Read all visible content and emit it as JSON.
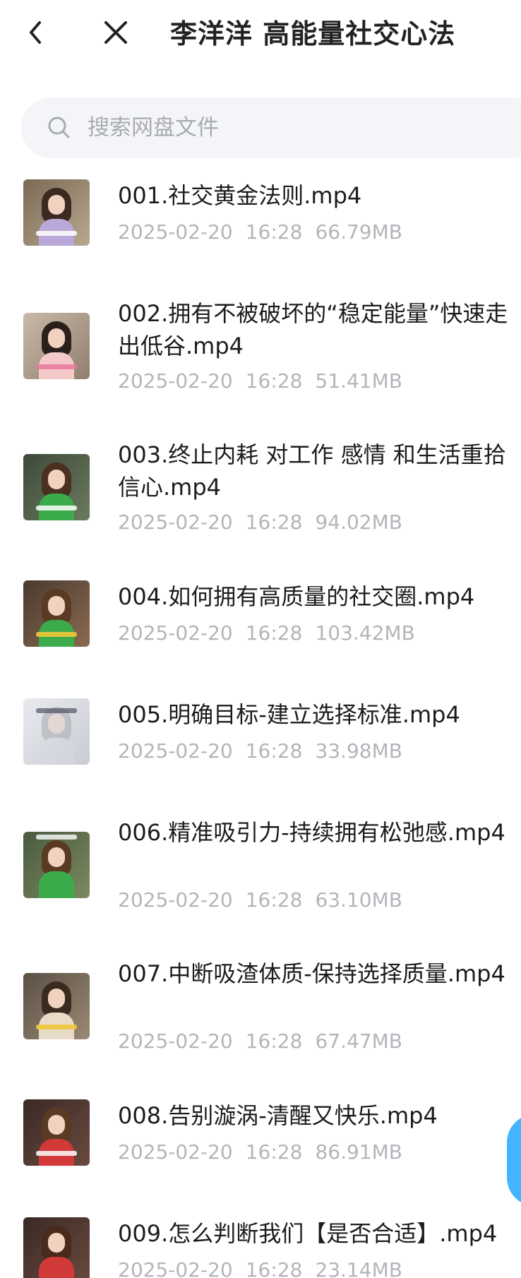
{
  "header": {
    "title": "李洋洋 高能量社交心法"
  },
  "search": {
    "placeholder": "搜索网盘文件"
  },
  "files": [
    {
      "name": "001.社交黄金法则.mp4",
      "date": "2025-02-20",
      "time": "16:28",
      "size": "66.79MB"
    },
    {
      "name": "002.拥有不被破坏的“稳定能量”快速走出低谷.mp4",
      "date": "2025-02-20",
      "time": "16:28",
      "size": "51.41MB"
    },
    {
      "name": "003.终止内耗  对工作 感情 和生活重拾信心.mp4",
      "date": "2025-02-20",
      "time": "16:28",
      "size": "94.02MB"
    },
    {
      "name": "004.如何拥有高质量的社交圈.mp4",
      "date": "2025-02-20",
      "time": "16:28",
      "size": "103.42MB"
    },
    {
      "name": "005.明确目标-建立选择标准.mp4",
      "date": "2025-02-20",
      "time": "16:28",
      "size": "33.98MB"
    },
    {
      "name": "006.精准吸引力-持续拥有松弛感.mp4",
      "date": "2025-02-20",
      "time": "16:28",
      "size": "63.10MB"
    },
    {
      "name": "007.中断吸渣体质-保持选择质量.mp4",
      "date": "2025-02-20",
      "time": "16:28",
      "size": "67.47MB"
    },
    {
      "name": "008.告别漩涡-清醒又快乐.mp4",
      "date": "2025-02-20",
      "time": "16:28",
      "size": "86.91MB"
    },
    {
      "name": "009.怎么判断我们【是否合适】.mp4",
      "date": "2025-02-20",
      "time": "16:28",
      "size": "23.14MB"
    }
  ]
}
